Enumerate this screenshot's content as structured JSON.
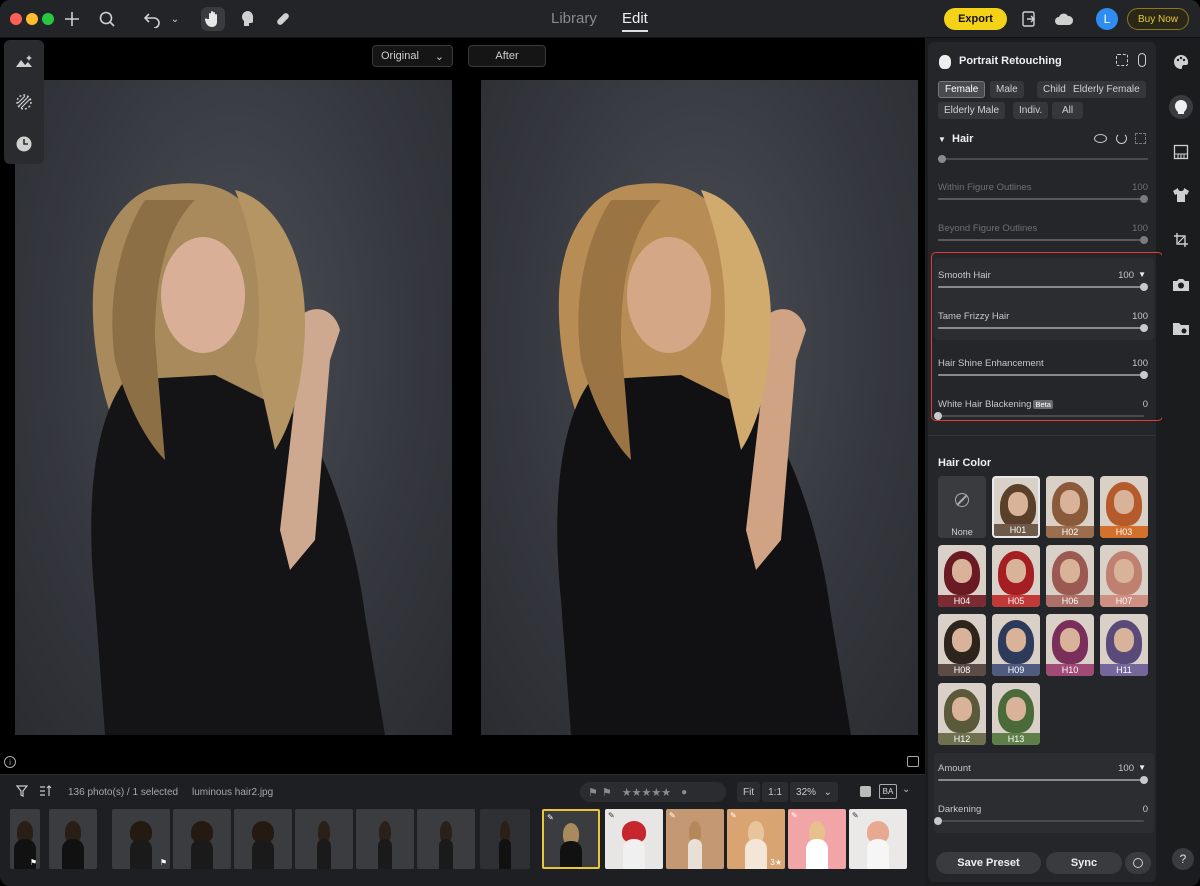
{
  "topbar": {
    "tabs": [
      "Library",
      "Edit"
    ],
    "active_tab": "Edit",
    "export_label": "Export",
    "avatar_initial": "L",
    "buy_label": "Buy Now",
    "accent": "#f4d218"
  },
  "canvas": {
    "original_label": "Original",
    "after_label": "After"
  },
  "filmstrip": {
    "photo_count": "136 photo(s) / 1 selected",
    "filename": "luminous hair2.jpg",
    "fit_label": "Fit",
    "one_to_one_label": "1:1",
    "zoom": "32%",
    "ba_label": "BA",
    "thumb_badge_star": "3★"
  },
  "panel": {
    "title": "Portrait Retouching",
    "groups": [
      "Female",
      "Male",
      "Child",
      "Elderly Female",
      "Elderly Male",
      "Indiv.",
      "All"
    ],
    "active_group": "Female",
    "hair_section": "Hair",
    "sliders_dim": [
      {
        "label": "Within Figure Outlines",
        "value": "100"
      },
      {
        "label": "Beyond Figure Outlines",
        "value": "100"
      }
    ],
    "smooth_hair": {
      "label": "Smooth Hair",
      "value": "100"
    },
    "tame_frizzy": {
      "label": "Tame Frizzy Hair",
      "value": "100"
    },
    "hair_shine": {
      "label": "Hair Shine Enhancement",
      "value": "100"
    },
    "white_hair": {
      "label": "White Hair Blackening",
      "value": "0",
      "badge": "Beta"
    },
    "hair_color_title": "Hair Color",
    "swatch_none": "None",
    "swatches": [
      "H01",
      "H02",
      "H03",
      "H04",
      "H05",
      "H06",
      "H07",
      "H08",
      "H09",
      "H10",
      "H11",
      "H12",
      "H13"
    ],
    "selected_swatch": "H01",
    "amount": {
      "label": "Amount",
      "value": "100"
    },
    "darkening": {
      "label": "Darkening",
      "value": "0"
    },
    "save_preset": "Save Preset",
    "sync": "Sync"
  },
  "help_label": "?"
}
